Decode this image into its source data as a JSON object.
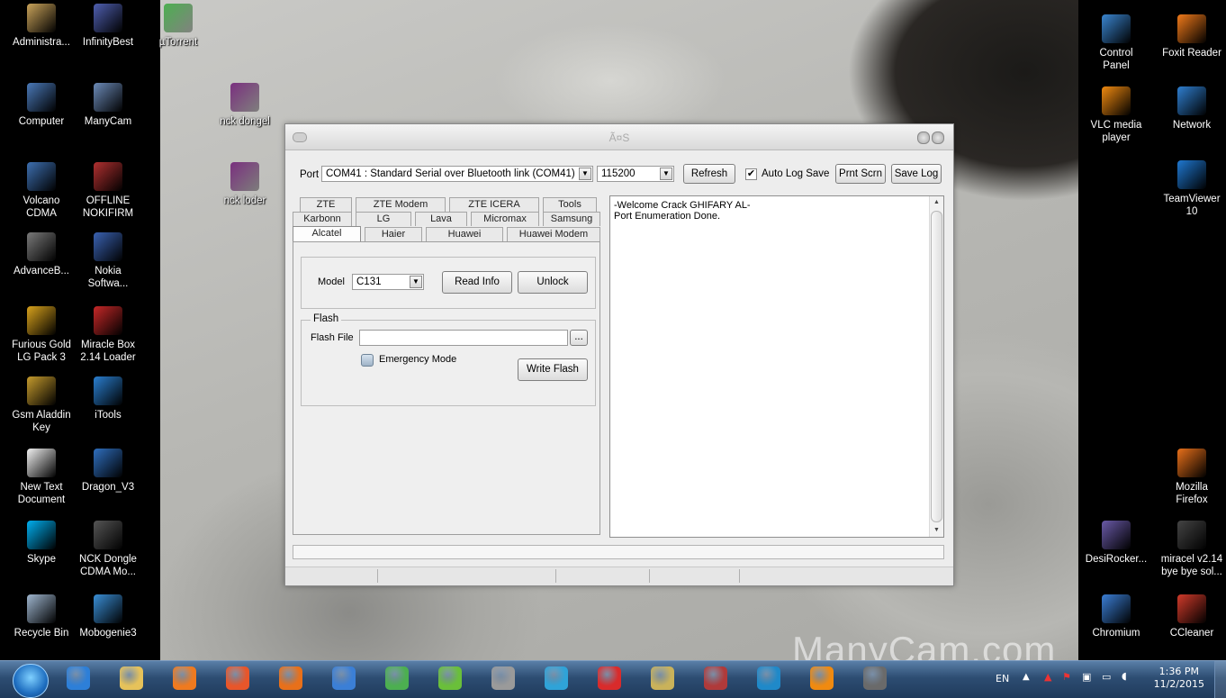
{
  "desktop": {
    "watermark": "ManyCam.com",
    "icons_left": [
      {
        "label": "Administra...",
        "icon": "folder-user-icon",
        "color": "#c9a35a"
      },
      {
        "label": "InfinityBest",
        "icon": "infinity-app-icon",
        "color": "#4f5fb0"
      },
      {
        "label": "µTorrent",
        "icon": "utorrent-icon",
        "color": "#4caf50"
      },
      {
        "label": "Computer",
        "icon": "computer-icon",
        "color": "#4a79b8"
      },
      {
        "label": "ManyCam",
        "icon": "manycam-icon",
        "color": "#6c8bb8"
      },
      {
        "label": "nck dongel",
        "icon": "winrar-archive-icon",
        "color": "#7a2f7f"
      },
      {
        "label": "Volcano\nCDMA",
        "icon": "volcano-icon",
        "color": "#3d6fb0"
      },
      {
        "label": "OFFLINE\nNOKIFIRM",
        "icon": "nokifirm-icon",
        "color": "#b03030"
      },
      {
        "label": "nck loder",
        "icon": "winrar-archive-icon",
        "color": "#7a2f7f"
      },
      {
        "label": "AdvanceB...",
        "icon": "advance-box-icon",
        "color": "#7a7a7a"
      },
      {
        "label": "Nokia\nSoftwa...",
        "icon": "nokia-software-icon",
        "color": "#3a62b2"
      },
      {
        "label": "Furious Gold\nLG Pack 3",
        "icon": "furious-gold-icon",
        "color": "#d8a21c"
      },
      {
        "label": "Miracle Box\n2.14 Loader",
        "icon": "miracle-box-icon",
        "color": "#c62828"
      },
      {
        "label": "Gsm Aladdin\nKey",
        "icon": "gsm-aladdin-icon",
        "color": "#c59b2d"
      },
      {
        "label": "iTools",
        "icon": "itools-icon",
        "color": "#2a7fd0"
      },
      {
        "label": "New Text\nDocument",
        "icon": "text-document-icon",
        "color": "#f2f2f2"
      },
      {
        "label": "Dragon_V3",
        "icon": "dragon-icon",
        "color": "#2f6fbf"
      },
      {
        "label": "Skype",
        "icon": "skype-icon",
        "color": "#00aff0"
      },
      {
        "label": "NCK Dongle\nCDMA Mo...",
        "icon": "nck-dongle-icon",
        "color": "#555555"
      },
      {
        "label": "Recycle Bin",
        "icon": "recycle-bin-icon",
        "color": "#9fb6cf"
      },
      {
        "label": "Mobogenie3",
        "icon": "mobogenie-icon",
        "color": "#3a8fd6"
      }
    ],
    "icons_right": [
      {
        "label": "Control\nPanel",
        "icon": "control-panel-icon",
        "color": "#3a86d0"
      },
      {
        "label": "Foxit Reader",
        "icon": "foxit-reader-icon",
        "color": "#f07a1a"
      },
      {
        "label": "VLC media\nplayer",
        "icon": "vlc-icon",
        "color": "#f08a10"
      },
      {
        "label": "Network",
        "icon": "network-icon",
        "color": "#2f7fd0"
      },
      {
        "label": "TeamViewer\n10",
        "icon": "teamviewer-icon",
        "color": "#1f78d1"
      },
      {
        "label": "Mozilla\nFirefox",
        "icon": "firefox-icon",
        "color": "#e8701a"
      },
      {
        "label": "DesiRocker...",
        "icon": "desirocker-icon",
        "color": "#6a5aa8"
      },
      {
        "label": "miracel v2.14\nbye bye sol...",
        "icon": "miracle-shortcut-icon",
        "color": "#444444"
      },
      {
        "label": "Chromium",
        "icon": "chromium-icon",
        "color": "#3b7fd6"
      },
      {
        "label": "CCleaner",
        "icon": "ccleaner-icon",
        "color": "#d03a2a"
      }
    ]
  },
  "window": {
    "title": "Ã¤S",
    "port_label": "Port",
    "port_value": "COM41 : Standard Serial over Bluetooth link (COM41)",
    "baud_value": "115200",
    "refresh_label": "Refresh",
    "auto_log_checked": true,
    "auto_log_label": "Auto Log Save",
    "print_screen_label": "Prnt Scrn",
    "save_log_label": "Save Log",
    "tabs_row1": [
      "ZTE",
      "ZTE Modem",
      "ZTE ICERA",
      "Tools"
    ],
    "tabs_row2": [
      "Karbonn",
      "LG",
      "Lava",
      "Micromax",
      "Samsung"
    ],
    "tabs_row3": [
      "Alcatel",
      "Haier",
      "Huawei",
      "Huawei Modem"
    ],
    "active_tab": "Alcatel",
    "model_label": "Model",
    "model_value": "C131",
    "read_info_label": "Read Info",
    "unlock_label": "Unlock",
    "flash_group_title": "Flash",
    "flash_file_label": "Flash File",
    "flash_file_value": "",
    "browse_label": "...",
    "emergency_mode_label": "Emergency Mode",
    "write_flash_label": "Write Flash",
    "log_lines": [
      "-Welcome Crack GHIFARY AL-",
      "Port Enumeration Done."
    ]
  },
  "taskbar": {
    "start_icon": "windows-start-icon",
    "items": [
      {
        "icon": "internet-explorer-icon",
        "color": "#2d7fd8"
      },
      {
        "icon": "file-explorer-icon",
        "color": "#e6c25a"
      },
      {
        "icon": "media-player-icon",
        "color": "#ef7a1f"
      },
      {
        "icon": "app-orange-icon",
        "color": "#e8562a"
      },
      {
        "icon": "firefox-icon",
        "color": "#e8701a"
      },
      {
        "icon": "chromium-icon",
        "color": "#3b7fd6"
      },
      {
        "icon": "ball-app-icon",
        "color": "#4caf50"
      },
      {
        "icon": "mrs-app-icon",
        "color": "#6abf3a"
      },
      {
        "icon": "usb-tool-icon",
        "color": "#9a9a9a"
      },
      {
        "icon": "globe-app-icon",
        "color": "#2fa3d8"
      },
      {
        "icon": "dongdian-app-icon",
        "color": "#d92b2b"
      },
      {
        "icon": "key-tool-icon",
        "color": "#c9b25a"
      },
      {
        "icon": "box-tool-icon",
        "color": "#b03a3a"
      },
      {
        "icon": "e-app-icon",
        "color": "#1f89c9"
      },
      {
        "icon": "vlc-icon",
        "color": "#f08a10"
      },
      {
        "icon": "nck-app-icon",
        "color": "#6a6a6a"
      }
    ],
    "language": "EN",
    "time": "1:36 PM",
    "date": "11/2/2015"
  }
}
